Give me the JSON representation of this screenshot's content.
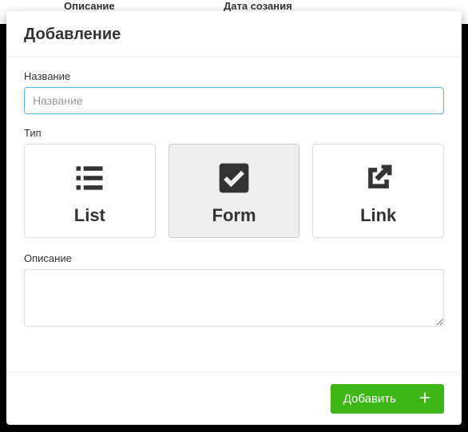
{
  "background": {
    "col1": "Описание",
    "col2": "Дата созания"
  },
  "dialog": {
    "title": "Добавление",
    "name": {
      "label": "Название",
      "placeholder": "Название",
      "value": ""
    },
    "type": {
      "label": "Тип",
      "options": [
        {
          "key": "list",
          "label": "List",
          "selected": false
        },
        {
          "key": "form",
          "label": "Form",
          "selected": true
        },
        {
          "key": "link",
          "label": "Link",
          "selected": false
        }
      ]
    },
    "description": {
      "label": "Описание",
      "value": ""
    },
    "footer": {
      "submit_label": "Добавить"
    }
  }
}
